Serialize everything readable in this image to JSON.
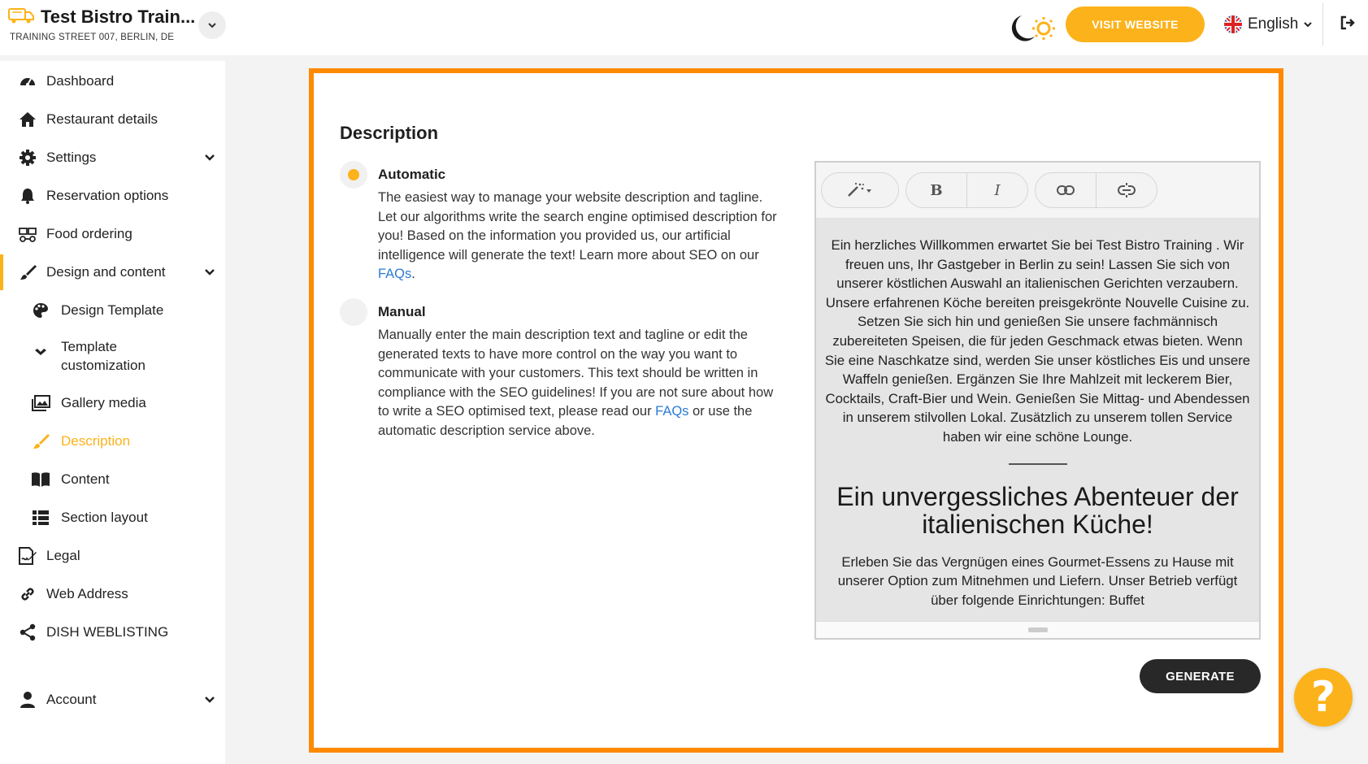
{
  "header": {
    "restaurant_name": "Test Bistro Train...",
    "address": "TRAINING STREET 007, BERLIN, DE",
    "visit_button": "VISIT WEBSITE",
    "language": "English",
    "icons": {
      "brand": "food-truck-icon",
      "toggle": "chevron-down-icon",
      "theme": "moon-sun-icon",
      "flag": "uk-flag-icon",
      "logout": "logout-icon"
    }
  },
  "colors": {
    "accent": "#fcb21a",
    "frame": "#ff8a00",
    "link": "#2c7bd6",
    "dark_button": "#282828"
  },
  "sidebar": {
    "items": [
      {
        "label": "Dashboard",
        "icon": "gauge-icon"
      },
      {
        "label": "Restaurant details",
        "icon": "home-icon"
      },
      {
        "label": "Settings",
        "icon": "gear-icon"
      },
      {
        "label": "Reservation options",
        "icon": "bell-icon"
      },
      {
        "label": "Food ordering",
        "icon": "food-delivery-icon"
      },
      {
        "label": "Design and content",
        "icon": "brush-icon"
      },
      {
        "label": "Design Template",
        "icon": "palette-icon"
      },
      {
        "label": "Template",
        "label2": "customization",
        "icon": "sliders-icon"
      },
      {
        "label": "Gallery media",
        "icon": "images-icon"
      },
      {
        "label": "Description",
        "icon": "pencil-icon"
      },
      {
        "label": "Content",
        "icon": "book-icon"
      },
      {
        "label": "Section layout",
        "icon": "list-icon"
      },
      {
        "label": "Legal",
        "icon": "document-sign-icon"
      },
      {
        "label": "Web Address",
        "icon": "link-icon"
      },
      {
        "label": "DISH WEBLISTING",
        "icon": "share-icon"
      },
      {
        "label": "Account",
        "icon": "user-icon"
      }
    ]
  },
  "main": {
    "title": "Description",
    "automatic": {
      "title": "Automatic",
      "text": "The easiest way to manage your website description and tagline. Let our algorithms write the search engine optimised description for you! Based on the information you provided us, our artificial intelligence will generate the text! Learn more about SEO on our ",
      "link": "FAQs",
      "text_end": ".",
      "selected": true
    },
    "manual": {
      "title": "Manual",
      "text": "Manually enter the main description text and tagline or edit the generated texts to have more control on the way you want to communicate with your customers. This text should be written in compliance with the SEO guidelines! If you are not sure about how to write a SEO optimised text, please read our ",
      "link": "FAQs",
      "text_end": " or use the automatic description service above.",
      "selected": false
    },
    "editor": {
      "toolbar": {
        "magic": "magic-wand-icon",
        "bold": "B",
        "italic": "I",
        "link": "link-icon",
        "unlink": "unlink-icon"
      },
      "paragraph1": "Ein herzliches Willkommen erwartet Sie bei Test Bistro Training . Wir freuen uns, Ihr Gastgeber in Berlin zu sein! Lassen Sie sich von unserer köstlichen Auswahl an italienischen Gerichten verzaubern. Unsere erfahrenen Köche bereiten preisgekrönte Nouvelle Cuisine zu. Setzen Sie sich hin und genießen Sie unsere fachmännisch zubereiteten Speisen, die für jeden Geschmack etwas bieten. Wenn Sie eine Naschkatze sind, werden Sie unser köstliches Eis und unsere Waffeln genießen. Ergänzen Sie Ihre Mahlzeit mit leckerem Bier, Cocktails, Craft-Bier und Wein. Genießen Sie Mittag- und Abendessen in unserem stilvollen Lokal. Zusätzlich zu unserem tollen Service haben wir eine schöne Lounge.",
      "heading": "Ein unvergessliches Abenteuer der italienischen Küche!",
      "paragraph2": "Erleben Sie das Vergnügen eines Gourmet-Essens zu Hause mit unserer Option zum Mitnehmen und Liefern. Unser Betrieb verfügt über folgende Einrichtungen: Buffet"
    },
    "generate_button": "GENERATE",
    "help_button": "?"
  }
}
